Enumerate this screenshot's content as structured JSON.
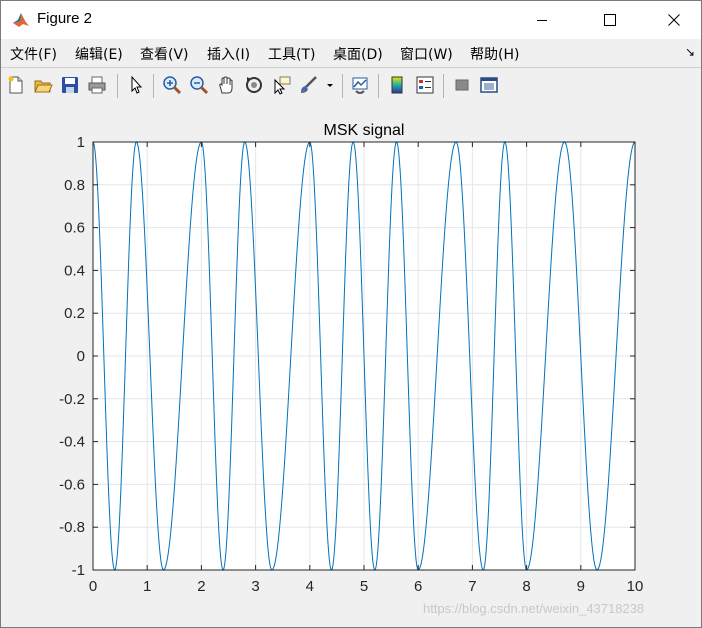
{
  "window": {
    "title": "Figure 2",
    "controls": {
      "minimize": "minimize",
      "maximize": "maximize",
      "close": "close"
    }
  },
  "menu": {
    "items": [
      "文件(F)",
      "编辑(E)",
      "查看(V)",
      "插入(I)",
      "工具(T)",
      "桌面(D)",
      "窗口(W)",
      "帮助(H)"
    ],
    "dock_arrow": "↘"
  },
  "toolbar": {
    "icons": [
      "new-figure-icon",
      "open-file-icon",
      "save-icon",
      "print-icon",
      "select-arrow-icon",
      "zoom-in-icon",
      "zoom-out-icon",
      "pan-hand-icon",
      "rotate-3d-icon",
      "data-cursor-icon",
      "brush-icon",
      "brush-dropdown-icon",
      "link-plot-icon",
      "colorbar-icon",
      "legend-icon",
      "hide-plot-tools-icon",
      "show-plot-tools-icon"
    ]
  },
  "chart_data": {
    "type": "line",
    "title": "MSK signal",
    "xlabel": "",
    "ylabel": "",
    "xlim": [
      0,
      10
    ],
    "ylim": [
      -1,
      1
    ],
    "xticks": [
      "0",
      "1",
      "2",
      "3",
      "4",
      "5",
      "6",
      "7",
      "8",
      "9",
      "10"
    ],
    "yticks": [
      "-1",
      "-0.8",
      "-0.6",
      "-0.4",
      "-0.2",
      "0",
      "0.2",
      "0.4",
      "0.6",
      "0.8",
      "1"
    ],
    "grid": true,
    "series": [
      {
        "color": "#0072bd",
        "x": [
          0,
          0.4,
          0.8,
          1.3,
          2.0,
          2.4,
          2.8,
          3.3,
          4.0,
          4.4,
          4.8,
          5.2,
          5.6,
          6.0,
          6.7,
          7.2,
          7.6,
          8.0,
          8.7,
          9.3,
          10.0
        ],
        "y": [
          1,
          -1,
          1,
          -1,
          1,
          -1,
          1,
          -1,
          1,
          -1,
          1,
          -1,
          1,
          -1,
          1,
          -1,
          1,
          -1,
          1,
          -1,
          1
        ]
      }
    ]
  },
  "watermark": "https://blog.csdn.net/weixin_43718238"
}
